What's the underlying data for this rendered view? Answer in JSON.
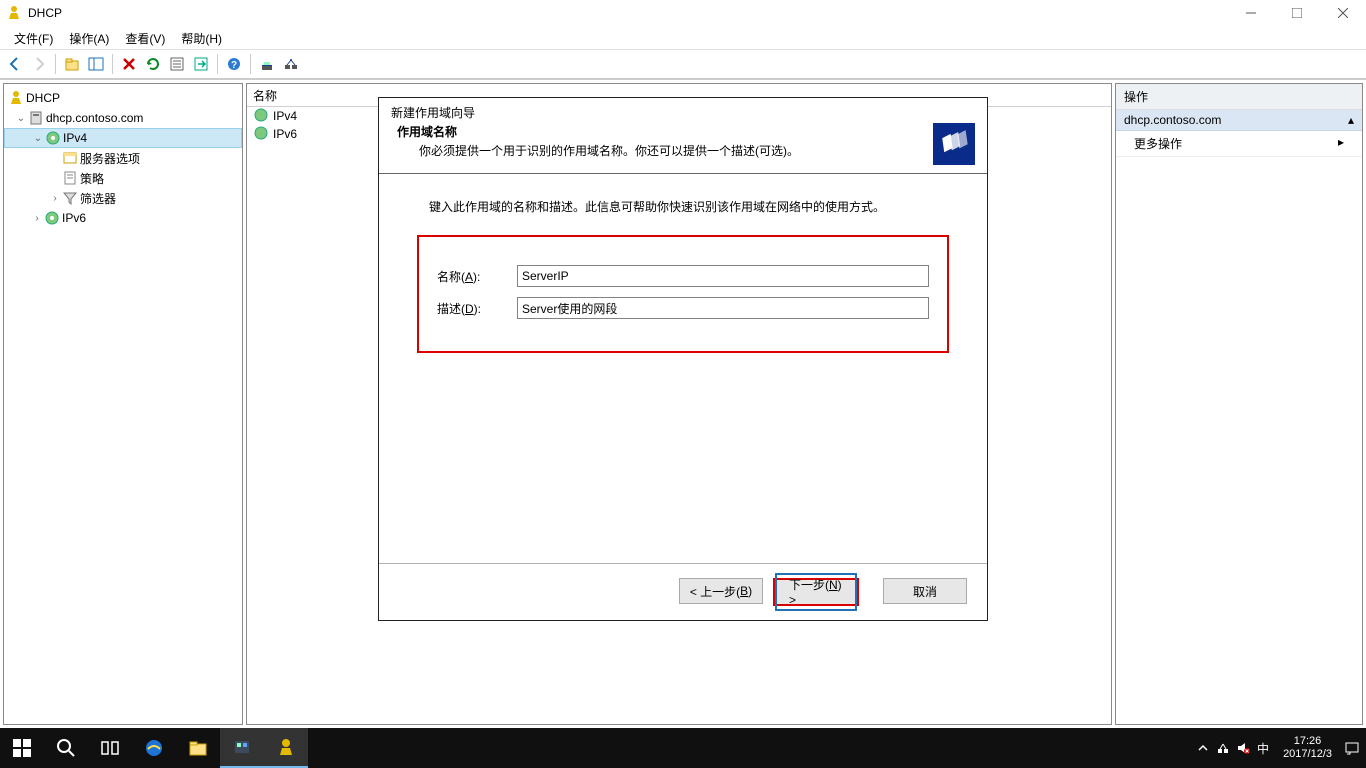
{
  "title": "DHCP",
  "menu": {
    "file": "文件(F)",
    "action": "操作(A)",
    "view": "查看(V)",
    "help": "帮助(H)"
  },
  "tree": {
    "root": "DHCP",
    "server": "dhcp.contoso.com",
    "ipv4": "IPv4",
    "ipv4_children": {
      "server_options": "服务器选项",
      "policies": "策略",
      "filters": "筛选器"
    },
    "ipv6": "IPv6"
  },
  "mid": {
    "header": "名称",
    "items": [
      "IPv4",
      "IPv6"
    ]
  },
  "right": {
    "title": "操作",
    "subtitle": "dhcp.contoso.com",
    "more": "更多操作"
  },
  "wizard": {
    "title": "新建作用域向导",
    "heading": "作用域名称",
    "subheading": "你必须提供一个用于识别的作用域名称。你还可以提供一个描述(可选)。",
    "instruction": "键入此作用域的名称和描述。此信息可帮助你快速识别该作用域在网络中的使用方式。",
    "name_label": "名称(A):",
    "name_value": "ServerIP",
    "desc_label": "描述(D):",
    "desc_value": "Server使用的网段",
    "back": "< 上一步(B)",
    "next": "下一步(N) >",
    "cancel": "取消"
  },
  "taskbar": {
    "ime": "中",
    "time": "17:26",
    "date": "2017/12/3"
  }
}
